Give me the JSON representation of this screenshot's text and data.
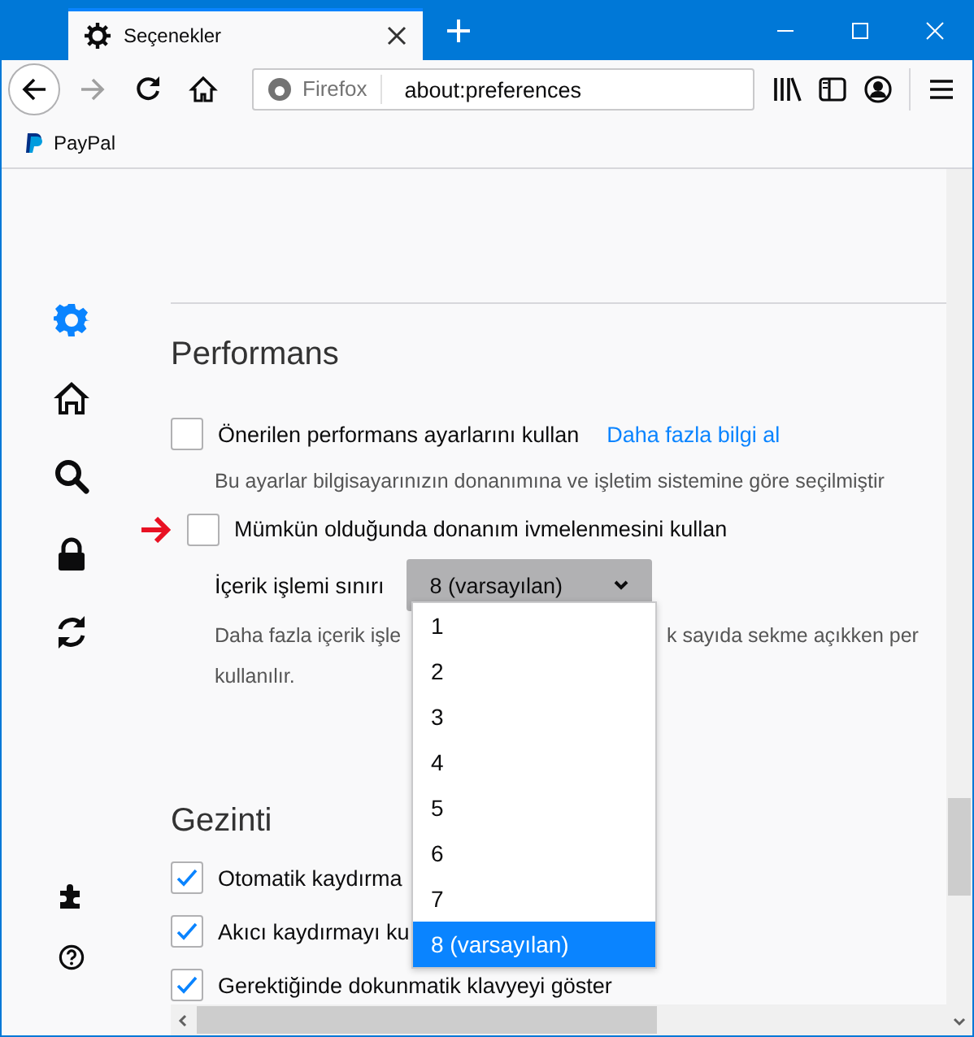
{
  "window": {
    "tab_title": "Seçenekler"
  },
  "toolbar": {
    "identity": "Firefox",
    "url": "about:preferences"
  },
  "bookmarks": [
    {
      "label": "PayPal"
    }
  ],
  "sidebar": {
    "items": [
      {
        "kind": "general",
        "selected": true
      },
      {
        "kind": "home",
        "selected": false
      },
      {
        "kind": "search",
        "selected": false
      },
      {
        "kind": "privacy",
        "selected": false
      },
      {
        "kind": "sync",
        "selected": false
      }
    ],
    "bottom_items": [
      {
        "kind": "extensions"
      },
      {
        "kind": "help"
      }
    ]
  },
  "performance": {
    "title": "Performans",
    "recommended": {
      "label": "Önerilen performans ayarlarını kullan",
      "checked": false,
      "link": "Daha fazla bilgi al"
    },
    "note": "Bu ayarlar bilgisayarınızın donanımına ve işletim sistemine göre seçilmiştir",
    "hardware": {
      "label": "Mümkün olduğunda donanım ivmelenmesini kullan",
      "checked": false
    },
    "process_limit": {
      "label": "İçerik işlemi sınırı",
      "value": "8 (varsayılan)",
      "options": [
        {
          "label": "1",
          "selected": false
        },
        {
          "label": "2",
          "selected": false
        },
        {
          "label": "3",
          "selected": false
        },
        {
          "label": "4",
          "selected": false
        },
        {
          "label": "5",
          "selected": false
        },
        {
          "label": "6",
          "selected": false
        },
        {
          "label": "7",
          "selected": false
        },
        {
          "label": "8 (varsayılan)",
          "selected": true
        }
      ]
    },
    "description": [
      "Daha fazla içerik işle",
      "k sayıda sekme açıkken per",
      "kullanılır."
    ]
  },
  "browsing": {
    "title": "Gezinti",
    "options": [
      {
        "label": "Otomatik kaydırma",
        "checked": true
      },
      {
        "label": "Akıcı kaydırmayı ku",
        "checked": true
      },
      {
        "label": "Gerektiğinde dokunmatik klavyeyi göster",
        "checked": true
      }
    ]
  }
}
